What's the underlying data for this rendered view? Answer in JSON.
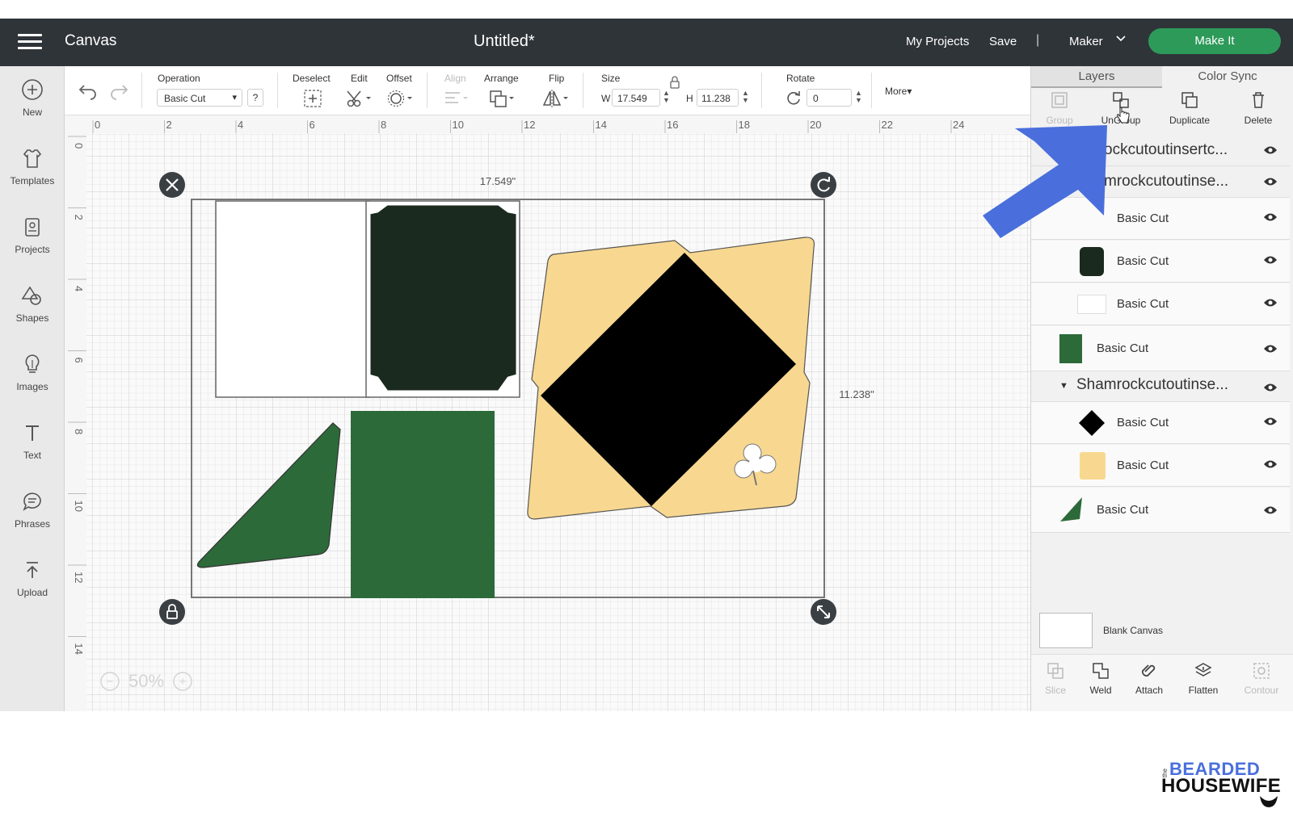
{
  "header": {
    "app_title": "Canvas",
    "doc_title": "Untitled*",
    "my_projects": "My Projects",
    "save": "Save",
    "separator": "|",
    "machine": "Maker",
    "make_it": "Make It"
  },
  "leftbar": {
    "items": [
      {
        "label": "New",
        "icon": "plus-circle-icon"
      },
      {
        "label": "Templates",
        "icon": "shirt-icon"
      },
      {
        "label": "Projects",
        "icon": "projects-icon"
      },
      {
        "label": "Shapes",
        "icon": "shapes-icon"
      },
      {
        "label": "Images",
        "icon": "lightbulb-icon"
      },
      {
        "label": "Text",
        "icon": "text-icon"
      },
      {
        "label": "Phrases",
        "icon": "speech-bubble-icon"
      },
      {
        "label": "Upload",
        "icon": "upload-icon"
      }
    ]
  },
  "toolbar": {
    "operation_label": "Operation",
    "operation_value": "Basic Cut",
    "help": "?",
    "deselect": "Deselect",
    "edit": "Edit",
    "offset": "Offset",
    "align": "Align",
    "arrange": "Arrange",
    "flip": "Flip",
    "size": "Size",
    "w_label": "W",
    "w_value": "17.549",
    "h_label": "H",
    "h_value": "11.238",
    "rotate": "Rotate",
    "rotate_value": "0",
    "more": "More▾"
  },
  "canvas": {
    "ruler_top": [
      "0",
      "2",
      "4",
      "6",
      "8",
      "10",
      "12",
      "14",
      "16",
      "18",
      "20",
      "22",
      "24"
    ],
    "ruler_left": [
      "0",
      "2",
      "4",
      "6",
      "8",
      "10",
      "12",
      "14"
    ],
    "width_readout": "17.549\"",
    "height_readout": "11.238\"",
    "zoom": "50%",
    "zoom_minus": "−",
    "zoom_plus": "+"
  },
  "panel": {
    "tab_layers": "Layers",
    "tab_color_sync": "Color Sync",
    "tools": {
      "group": "Group",
      "ungroup": "UnGroup",
      "duplicate": "Duplicate",
      "delete": "Delete"
    },
    "layers": [
      {
        "name": "ockcutoutinsertc..."
      },
      {
        "name": "mrockcutoutinse..."
      },
      {
        "name": "Basic Cut"
      },
      {
        "name": "Basic Cut"
      },
      {
        "name": "Basic Cut"
      },
      {
        "name": "Basic Cut"
      },
      {
        "name": "Shamrockcutoutinse..."
      },
      {
        "name": "Basic Cut"
      },
      {
        "name": "Basic Cut"
      },
      {
        "name": "Basic Cut"
      }
    ],
    "blank_canvas": "Blank Canvas",
    "bottom": {
      "slice": "Slice",
      "weld": "Weld",
      "attach": "Attach",
      "flatten": "Flatten",
      "contour": "Contour"
    }
  },
  "logo": {
    "small": "the",
    "line1": "BEARDED",
    "line2": "HOUSEWIFE"
  },
  "colors": {
    "header_bg": "#2f3439",
    "make_it": "#2d9a5a",
    "dark_green": "#1b2a1e",
    "green": "#2c6a3a",
    "tan": "#f8d890",
    "arrow_blue": "#4a6fdc"
  }
}
